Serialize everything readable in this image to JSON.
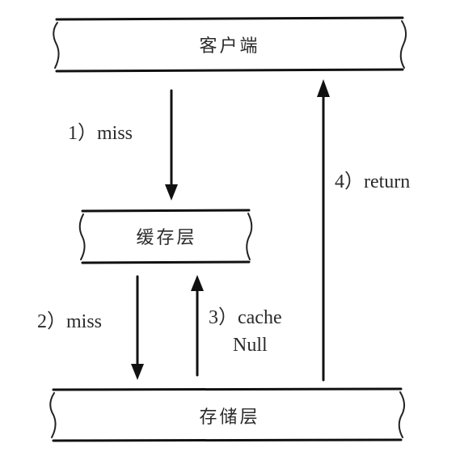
{
  "nodes": {
    "client": {
      "label": "客户端"
    },
    "cache": {
      "label": "缓存层"
    },
    "storage": {
      "label": "存储层"
    }
  },
  "edges": {
    "step1": {
      "label": "1）miss"
    },
    "step2": {
      "label": "2）miss"
    },
    "step3": {
      "label_line1": "3）cache",
      "label_line2": "Null"
    },
    "step4": {
      "label": "4）return"
    }
  }
}
